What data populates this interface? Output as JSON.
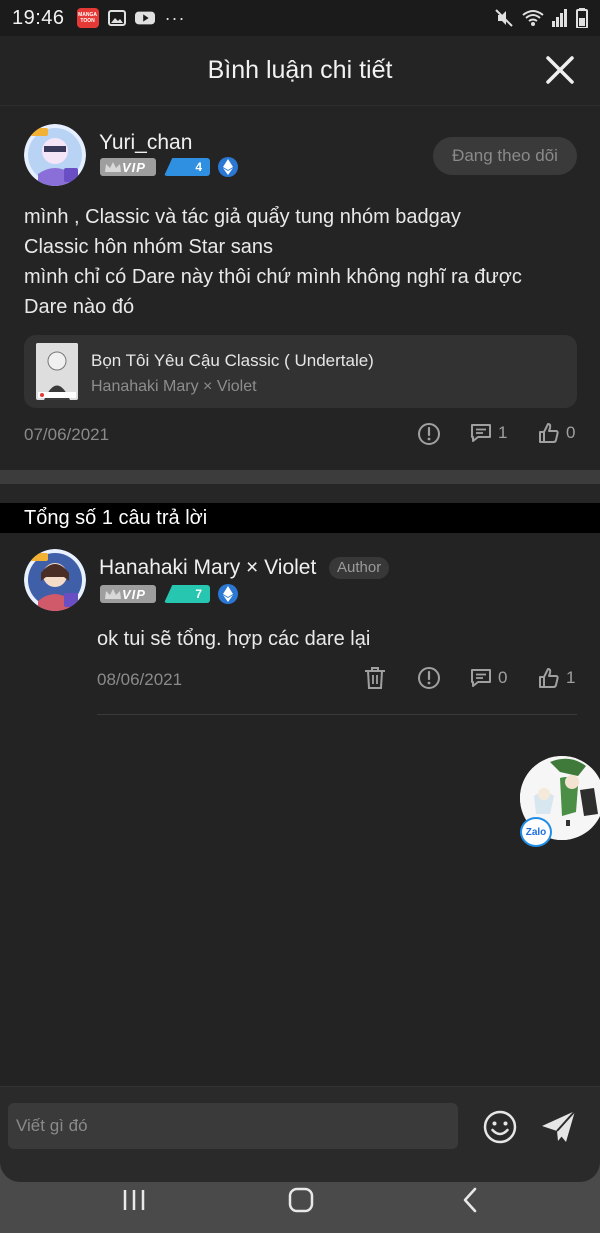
{
  "status_bar": {
    "time": "19:46",
    "app_icons": [
      "manga-toon-icon",
      "gallery-icon",
      "youtube-icon"
    ],
    "more": "···",
    "manga_label": "MANGA TOON"
  },
  "header": {
    "title": "Bình luận chi tiết",
    "close_icon": "close-icon"
  },
  "comment": {
    "username": "Yuri_chan",
    "vip_label": "VIP",
    "level": "4",
    "follow_label": "Đang theo dõi",
    "lines": [
      "mình , Classic và tác giả quẩy tung nhóm badgay",
      "Classic hôn nhóm Star sans",
      "mình chỉ có Dare này thôi chứ mình không nghĩ ra được",
      "Dare nào đó"
    ],
    "story": {
      "title": "Bọn Tôi Yêu Cậu Classic ( Undertale)",
      "author": "Hanahaki Mary × Violet"
    },
    "date": "07/06/2021",
    "reply_count": "1",
    "like_count": "0"
  },
  "replies": {
    "header": "Tổng số 1 câu trả lời",
    "items": [
      {
        "username": "Hanahaki Mary × Violet",
        "author_tag": "Author",
        "vip_label": "VIP",
        "level": "7",
        "text": "ok tui sẽ tổng. hợp các dare lại",
        "date": "08/06/2021",
        "reply_count": "0",
        "like_count": "1"
      }
    ]
  },
  "floating": {
    "zalo_label": "Zalo"
  },
  "input": {
    "placeholder": "Viết gì đó"
  },
  "colors": {
    "background": "#242424",
    "vip_grey": "#9e9e9e",
    "level4_blue": "#2f8fe0",
    "level7_teal": "#26c6b0",
    "eth_blue": "#2a78d4"
  }
}
